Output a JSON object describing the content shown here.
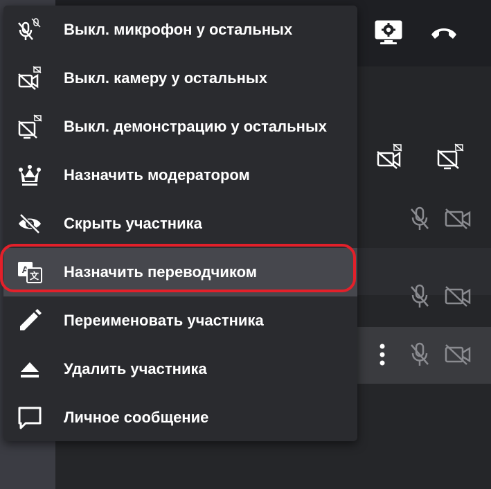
{
  "menu": {
    "items": [
      {
        "label": "Выкл. микрофон у остальных",
        "icon": "mic-off-all-icon"
      },
      {
        "label": "Выкл. камеру у остальных",
        "icon": "camera-off-all-icon"
      },
      {
        "label": "Выкл. демонстрацию у остальных",
        "icon": "screenshare-off-all-icon"
      },
      {
        "label": "Назначить модератором",
        "icon": "crown-icon"
      },
      {
        "label": "Скрыть участника",
        "icon": "eye-off-icon"
      },
      {
        "label": "Назначить переводчиком",
        "icon": "translate-icon"
      },
      {
        "label": "Переименовать участника",
        "icon": "pencil-icon"
      },
      {
        "label": "Удалить участника",
        "icon": "eject-icon"
      },
      {
        "label": "Личное сообщение",
        "icon": "chat-bubble-icon"
      }
    ],
    "highlighted_item": "Назначить переводчиком"
  },
  "toolbar": {
    "icons": [
      "screen-settings-icon",
      "hang-up-icon"
    ]
  },
  "participants_panel": {
    "header_icons": [
      "camera-off-all-icon",
      "screenshare-off-all-icon"
    ],
    "rows": [
      {
        "icons": [
          "mic-off-icon",
          "camera-off-icon"
        ]
      },
      {
        "icons": [
          "mic-off-icon",
          "camera-off-icon"
        ]
      },
      {
        "icons": [
          "more-vertical-icon",
          "mic-off-icon",
          "camera-off-icon"
        ]
      }
    ]
  },
  "colors": {
    "menu_background": "#2a2b2f",
    "active_item": "#46474d",
    "focus_ring": "#e3202a",
    "text": "#ffffff",
    "muted_icon": "#8a8b90"
  }
}
